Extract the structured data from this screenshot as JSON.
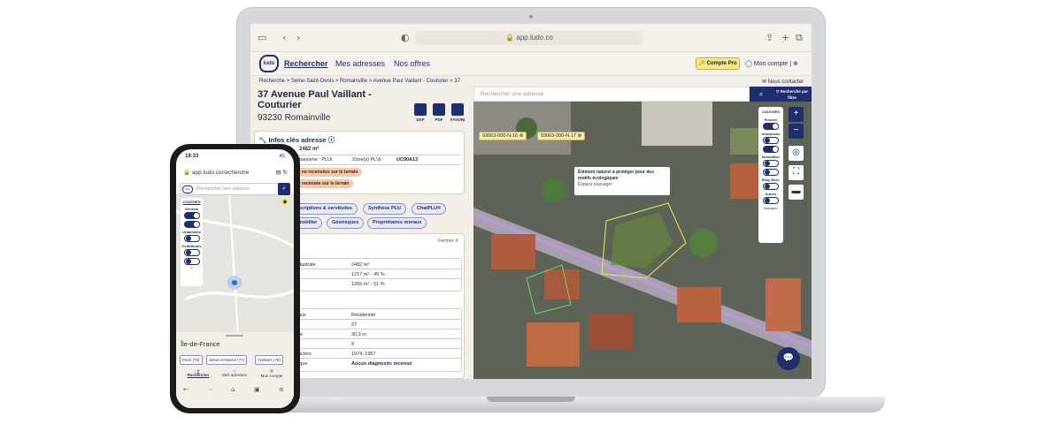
{
  "browser": {
    "url": "app.ludo.co"
  },
  "nav": {
    "logo": "ludo",
    "search": "Rechercher",
    "addresses": "Mes adresses",
    "offers": "Nos offres",
    "pro": "Compte Pro",
    "account": "Mon compte"
  },
  "breadcrumb": "Recherche > Seine-Saint-Denis > Romainville > Avenue Paul Vaillant - Couturier > 37",
  "contact": "Nous contacter",
  "address": {
    "title": "37 Avenue Paul Vaillant - Couturier",
    "city": "93230 Romainville"
  },
  "actions": [
    "DXF",
    "PDF",
    "FAVORI"
  ],
  "infos": {
    "title": "Infos clés adresse",
    "surface": "2482 m²",
    "zonage_label": "banisme : PLUi",
    "zone_label": "Zone(s) PLUi :",
    "zone": "UC90A13",
    "chips": [
      "ns recensées sur le terrain",
      "recensée sur le terrain"
    ]
  },
  "tabs": [
    "scriptions & servitudes",
    "Synthèse PLU",
    "ChatPLU®",
    "mobilier",
    "Géorisques",
    "Propriétaires moraux"
  ],
  "close": "Fermer X",
  "table1": [
    [
      "dastrale",
      "2482 m²"
    ],
    [
      "",
      "1217 m² - 49 %"
    ],
    [
      "",
      "1265 m² - 51 %"
    ]
  ],
  "table2": [
    [
      "aux",
      "Résidentiel"
    ],
    [
      "",
      "27"
    ],
    [
      "re",
      "30.3 m"
    ],
    [
      "",
      "9"
    ],
    [
      "uction",
      "1974, 1957"
    ],
    [
      "ique",
      "Aucun diagnostic recensé"
    ]
  ],
  "map": {
    "search_placeholder": "Rechercher une adresse",
    "filter": "Recherche par filtre",
    "parcels": [
      "93063-000-N-16",
      "93063-000-N-17"
    ],
    "tooltip": {
      "title": "Élément naturel à protéger pour des motifs écologiques",
      "sub": "Espace paysager"
    },
    "layers": {
      "title": "COUCHES",
      "groups": [
        "Foncier",
        "Urbanisme",
        "Immobilier",
        "Risq./Serv.",
        "Autres"
      ],
      "footer": "Masquer"
    },
    "zoom_in": "+",
    "zoom_out": "−"
  },
  "phone": {
    "time": "18:33",
    "signal": "4G",
    "url": "app.ludo.co/recherche",
    "search_placeholder": "Rechercher une adresse",
    "layers": {
      "title": "COUCHES",
      "groups": [
        "Général",
        "Urbanisme",
        "Contraintes"
      ]
    },
    "region": "Île-de-France",
    "departments": [
      "Paris (75)",
      "Seine-et-Marne (77)",
      "Yvelines (78)"
    ],
    "tabs": [
      "Rechercher",
      "Mes adresses",
      "Mon compte"
    ]
  }
}
